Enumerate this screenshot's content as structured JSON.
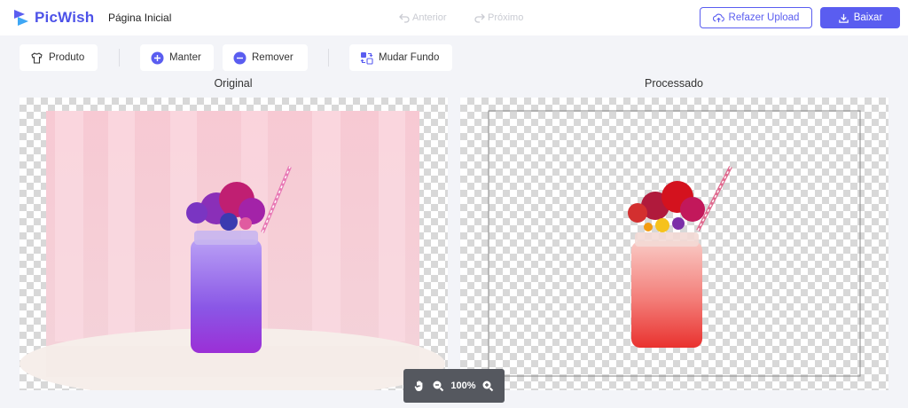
{
  "app": {
    "name": "PicWish",
    "brand_color": "#4d52e8"
  },
  "header": {
    "home_label": "Página Inicial",
    "prev_label": "Anterior",
    "next_label": "Próximo",
    "reupload_label": "Refazer Upload",
    "download_label": "Baixar"
  },
  "toolbar": {
    "produto_label": "Produto",
    "manter_label": "Manter",
    "remover_label": "Remover",
    "mudar_fundo_label": "Mudar Fundo"
  },
  "panels": {
    "original_title": "Original",
    "processed_title": "Processado"
  },
  "zoom": {
    "level": "100%"
  },
  "icons": {
    "logo": "picwish-logo-icon",
    "prev": "undo-icon",
    "next": "redo-icon",
    "reupload": "cloud-upload-icon",
    "download": "download-icon",
    "produto": "shirt-icon",
    "manter": "plus-circle-icon",
    "remover": "minus-circle-icon",
    "mudar_fundo": "swap-background-icon",
    "pan": "hand-icon",
    "zoom_out": "zoom-out-icon",
    "zoom_in": "zoom-in-icon"
  }
}
